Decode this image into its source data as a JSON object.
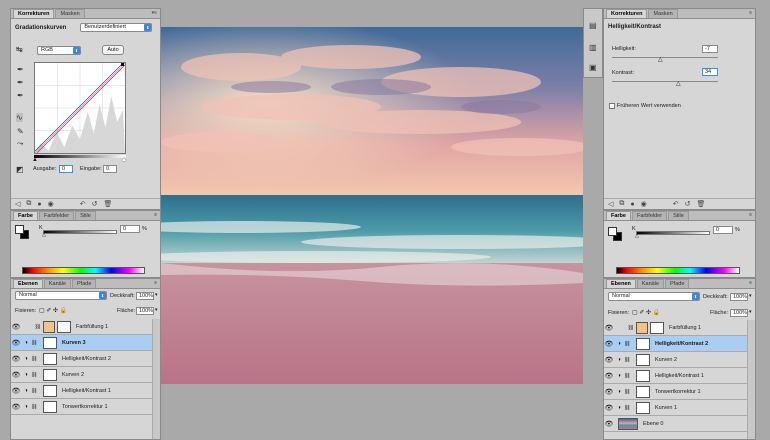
{
  "left_top": {
    "tabs": [
      "Korrekturen",
      "Masken"
    ],
    "title": "Gradationskurven",
    "preset": "Benutzerdefiniert",
    "channel": "RGB",
    "auto": "Auto",
    "output_label": "Ausgabe:",
    "output_value": "0",
    "input_label": "Eingabe:",
    "input_value": "0"
  },
  "left_color": {
    "tabs": [
      "Farbe",
      "Farbfelder",
      "Stile"
    ],
    "k_label": "K",
    "k_value": "0",
    "percent": "%"
  },
  "left_layers": {
    "tabs": [
      "Ebenen",
      "Kanäle",
      "Pfade"
    ],
    "blend_mode": "Normal",
    "opacity_label": "Deckkraft:",
    "opacity_value": "100%",
    "lock_label": "Fixieren:",
    "fill_label": "Fläche:",
    "fill_value": "100%",
    "layers": [
      {
        "name": "Farbfüllung 1",
        "selected": false,
        "thumb": "#f2c489"
      },
      {
        "name": "Kurven 3",
        "selected": true,
        "thumb": "#ffffff"
      },
      {
        "name": "Helligkeit/Kontrast 2",
        "selected": false,
        "thumb": "#ffffff"
      },
      {
        "name": "Kurven 2",
        "selected": false,
        "thumb": "#ffffff"
      },
      {
        "name": "Helligkeit/Kontrast 1",
        "selected": false,
        "thumb": "#ffffff"
      },
      {
        "name": "Tonwertkorrektur 1",
        "selected": false,
        "thumb": "#ffffff"
      }
    ]
  },
  "right_top": {
    "tabs": [
      "Korrekturen",
      "Masken"
    ],
    "title": "Helligkeit/Kontrast",
    "brightness_label": "Helligkeit:",
    "brightness_value": "-7",
    "brightness_level": 0.48,
    "contrast_label": "Kontrast:",
    "contrast_value": "34",
    "contrast_level": 0.58,
    "legacy_label": "Früheren Wert verwenden"
  },
  "right_color": {
    "tabs": [
      "Farbe",
      "Farbfelder",
      "Stile"
    ],
    "k_label": "K",
    "k_value": "0",
    "percent": "%"
  },
  "right_layers": {
    "tabs": [
      "Ebenen",
      "Kanäle",
      "Pfade"
    ],
    "blend_mode": "Normal",
    "opacity_label": "Deckkraft:",
    "opacity_value": "100%",
    "lock_label": "Fixieren:",
    "fill_label": "Fläche:",
    "fill_value": "100%",
    "layers": [
      {
        "name": "Farbfüllung 1",
        "selected": false,
        "thumb": "#f2c489"
      },
      {
        "name": "Helligkeit/Kontrast 2",
        "selected": true,
        "thumb": "#ffffff"
      },
      {
        "name": "Kurven 2",
        "selected": false,
        "thumb": "#ffffff"
      },
      {
        "name": "Helligkeit/Kontrast 1",
        "selected": false,
        "thumb": "#ffffff"
      },
      {
        "name": "Tonwertkorrektur 1",
        "selected": false,
        "thumb": "#ffffff"
      },
      {
        "name": "Kurven 1",
        "selected": false,
        "thumb": "#ffffff"
      },
      {
        "name": "Ebene 0",
        "selected": false,
        "thumb": "#e58f6a"
      }
    ]
  },
  "colors": {
    "accent": "#3a86de",
    "selected_row": "#a9cdf3",
    "panel_bg": "#d6d6d6"
  }
}
